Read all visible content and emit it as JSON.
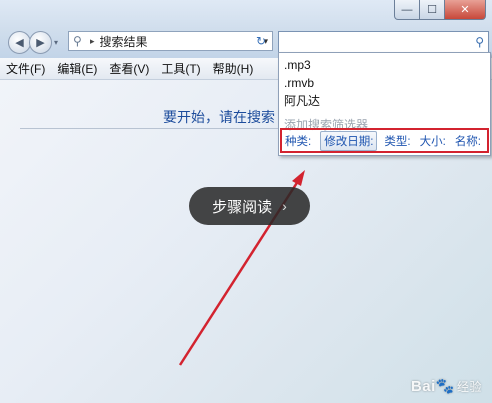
{
  "window": {
    "caption_buttons": {
      "minimize": "—",
      "maximize": "☐",
      "close": "✕"
    }
  },
  "nav": {
    "back": "◀",
    "forward": "▶",
    "dropdown": "▾"
  },
  "address": {
    "breadcrumb": "搜索结果",
    "separator": "▸",
    "dropdown": "▾",
    "refresh": "↻"
  },
  "search": {
    "value": "",
    "placeholder": "",
    "magnifier": "⚲"
  },
  "menu": {
    "items": [
      "文件(F)",
      "编辑(E)",
      "查看(V)",
      "工具(T)",
      "帮助(H)"
    ]
  },
  "content": {
    "hint": "要开始，请在搜索"
  },
  "dropdown": {
    "suggestions": [
      ".mp3",
      ".rmvb",
      "阿凡达"
    ],
    "filter_title": "添加搜索筛选器",
    "filters": [
      "种类:",
      "修改日期:",
      "类型:",
      "大小:",
      "名称:"
    ],
    "active_filter": "修改日期:"
  },
  "overlay": {
    "label": "步骤阅读",
    "arrow": "›"
  },
  "watermark": {
    "brand": "Bai",
    "paw": "🐾",
    "tail": "经验"
  },
  "annotation": {
    "color": "#d3232f"
  }
}
